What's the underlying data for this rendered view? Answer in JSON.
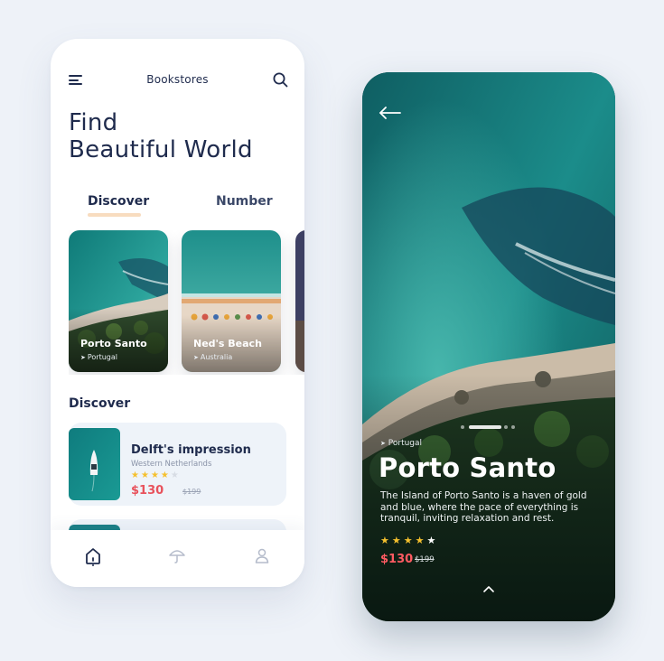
{
  "left_screen": {
    "header": {
      "title": "Bookstores",
      "menu_icon": "menu-icon",
      "search_icon": "search-icon"
    },
    "headline": {
      "line1": "Find",
      "line2": "Beautiful World"
    },
    "tabs": [
      {
        "label": "Discover",
        "active": true
      },
      {
        "label": "Number",
        "active": false
      }
    ],
    "cards": [
      {
        "title": "Porto Santo",
        "location": "Portugal"
      },
      {
        "title": "Ned's Beach",
        "location": "Australia"
      }
    ],
    "section_title": "Discover",
    "list": [
      {
        "title": "Delft's impression",
        "subtitle": "Western Netherlands",
        "rating": 4,
        "max_rating": 5,
        "price": "$130",
        "old_price": "$199"
      }
    ],
    "bottom_nav": [
      {
        "icon": "home-icon",
        "active": true
      },
      {
        "icon": "umbrella-icon",
        "active": false
      },
      {
        "icon": "user-icon",
        "active": false
      }
    ]
  },
  "right_screen": {
    "back_icon": "arrow-left-icon",
    "location": "Portugal",
    "title": "Porto Santo",
    "description": "The Island of Porto Santo is a haven of gold and blue, where the pace of everything is tranquil, inviting relaxation and rest.",
    "rating": 5,
    "price": "$130",
    "old_price": "$199",
    "carousel": {
      "count": 4,
      "active": 1
    },
    "expand_icon": "chevron-up-icon"
  },
  "colors": {
    "navy": "#1f2b4d",
    "price_red": "#e8525c",
    "star_yellow": "#f5c02e",
    "tab_underline": "#f8dcbf",
    "card_bg": "#eef3f9"
  }
}
